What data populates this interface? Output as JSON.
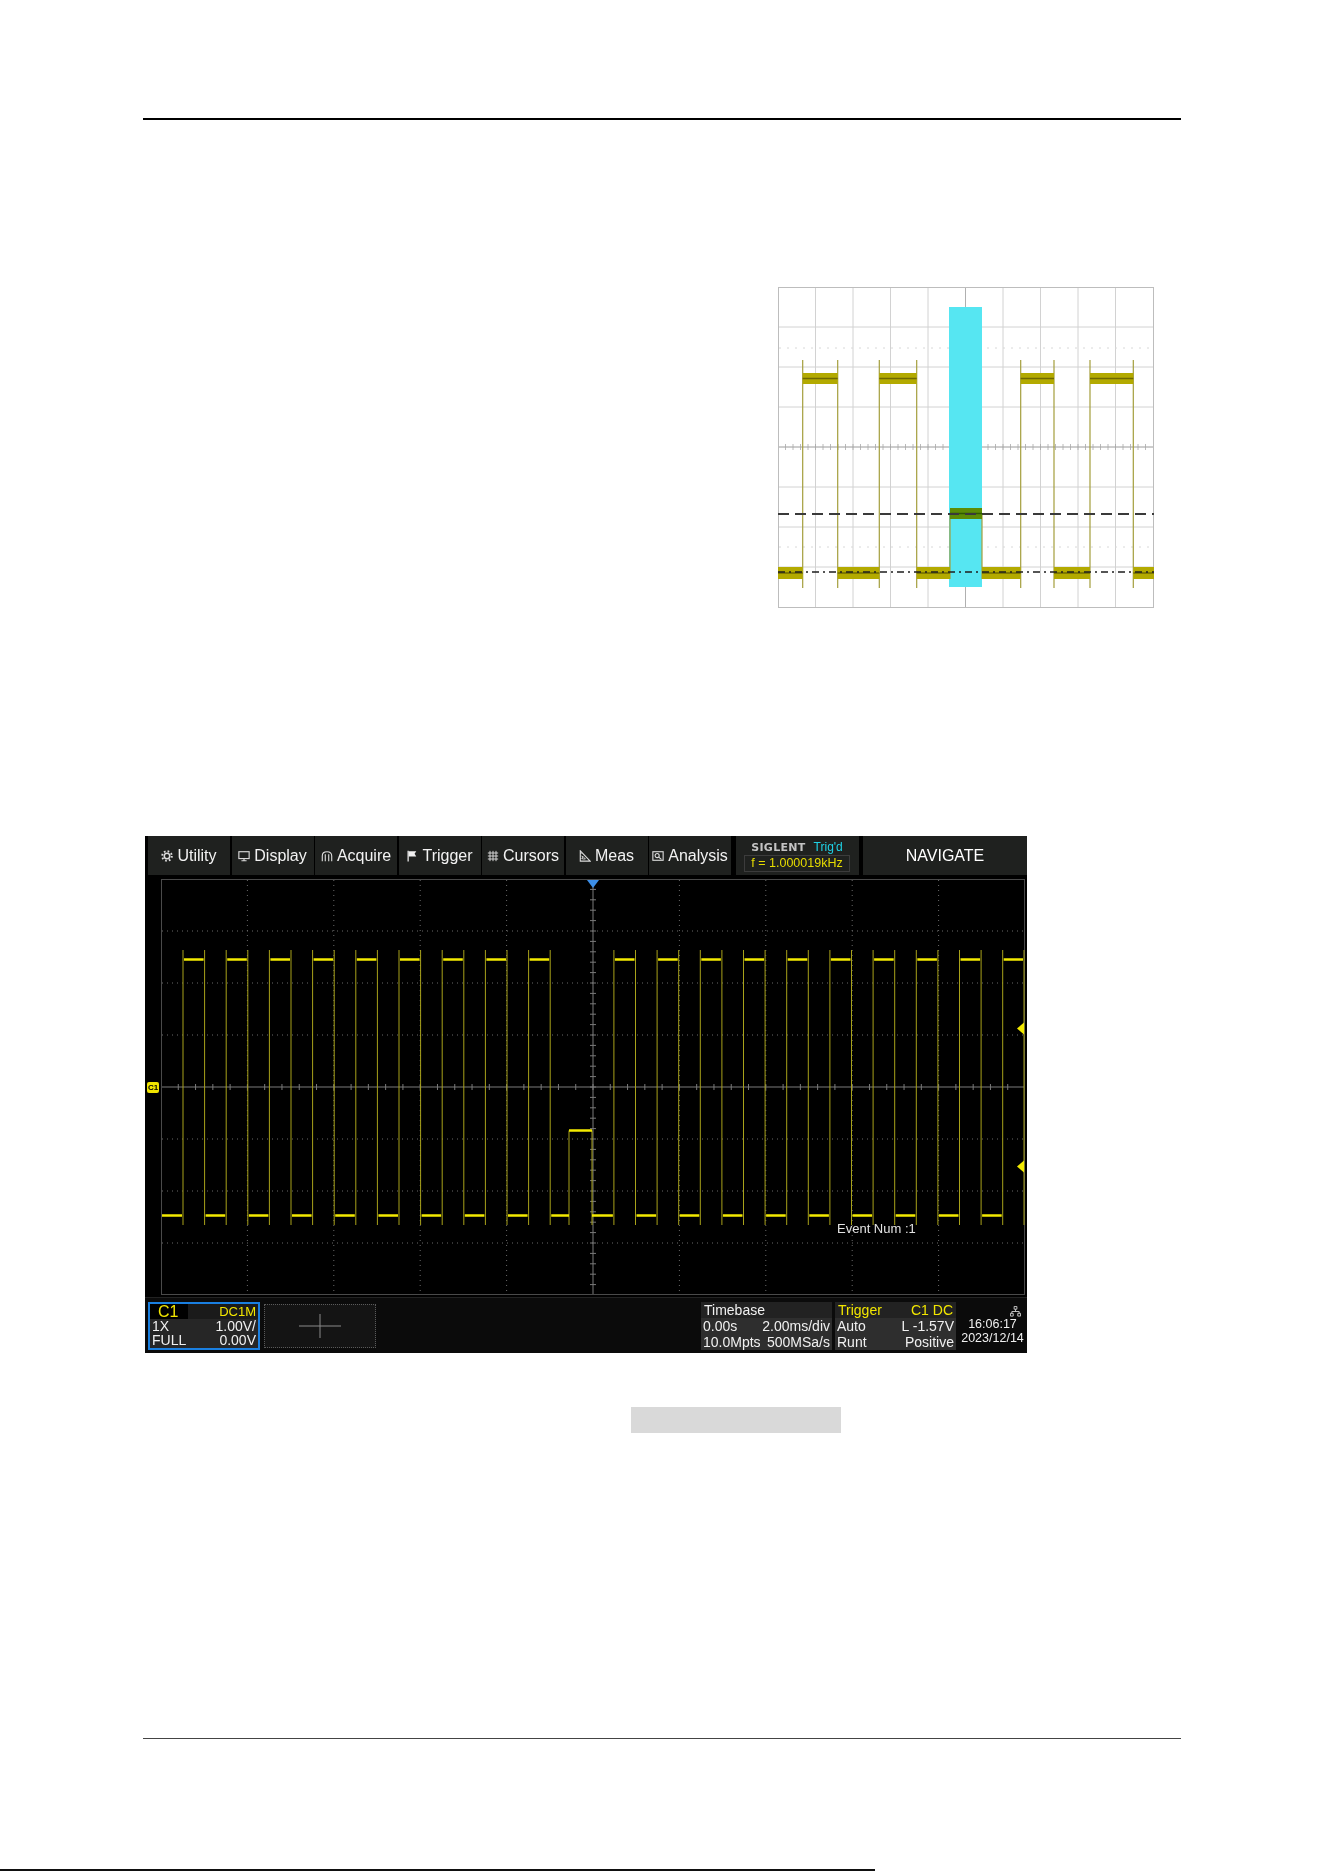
{
  "scope": {
    "menu": [
      {
        "label": "Utility"
      },
      {
        "label": "Display"
      },
      {
        "label": "Acquire"
      },
      {
        "label": "Trigger"
      },
      {
        "label": "Cursors"
      },
      {
        "label": "Meas"
      },
      {
        "label": "Analysis"
      }
    ],
    "status": {
      "brand": "SIGLENT",
      "state": "Trig'd",
      "frequency": "f = 1.000019kHz"
    },
    "navigate": "NAVIGATE",
    "channel_marker": "C1",
    "event": "Event Num :1",
    "channel": {
      "name": "C1",
      "coupling": "DC1M",
      "selected": true,
      "rows": [
        {
          "label": "1X",
          "value": "1.00V/"
        },
        {
          "label": "FULL",
          "value": "0.00V"
        }
      ]
    },
    "timebase": {
      "title": "Timebase",
      "rows": [
        {
          "label": "0.00s",
          "value": "2.00ms/div"
        },
        {
          "label": "10.0Mpts",
          "value": "500MSa/s"
        }
      ]
    },
    "trigger": {
      "title": "Trigger",
      "source": "C1 DC",
      "rows": [
        {
          "label": "Auto",
          "value": "L -1.57V"
        },
        {
          "label": "Runt",
          "value": "Positive"
        }
      ]
    },
    "clock": {
      "time": "16:06:17",
      "date": "2023/12/14"
    }
  }
}
